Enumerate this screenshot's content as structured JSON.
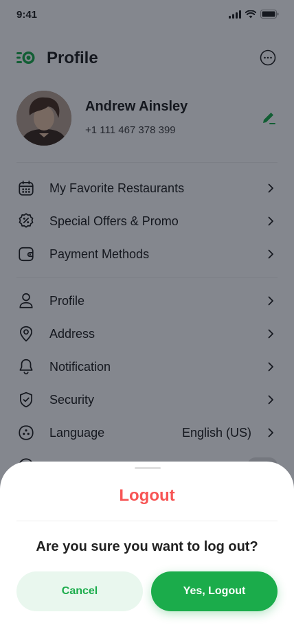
{
  "status_bar": {
    "time": "9:41"
  },
  "header": {
    "title": "Profile"
  },
  "user": {
    "name": "Andrew Ainsley",
    "phone": "+1 111 467 378 399"
  },
  "menu_group_1": [
    {
      "label": "My Favorite Restaurants",
      "icon": "calendar-icon"
    },
    {
      "label": "Special Offers & Promo",
      "icon": "discount-icon"
    },
    {
      "label": "Payment Methods",
      "icon": "wallet-icon"
    }
  ],
  "menu_group_2": [
    {
      "label": "Profile",
      "icon": "user-icon"
    },
    {
      "label": "Address",
      "icon": "location-icon"
    },
    {
      "label": "Notification",
      "icon": "bell-icon"
    },
    {
      "label": "Security",
      "icon": "shield-icon"
    },
    {
      "label": "Language",
      "value": "English (US)",
      "icon": "language-icon"
    }
  ],
  "logout_sheet": {
    "title": "Logout",
    "message": "Are you sure you want to log out?",
    "cancel_label": "Cancel",
    "confirm_label": "Yes, Logout"
  },
  "colors": {
    "primary": "#1bac4b",
    "danger": "#f75555",
    "overlay": "#09101d"
  }
}
